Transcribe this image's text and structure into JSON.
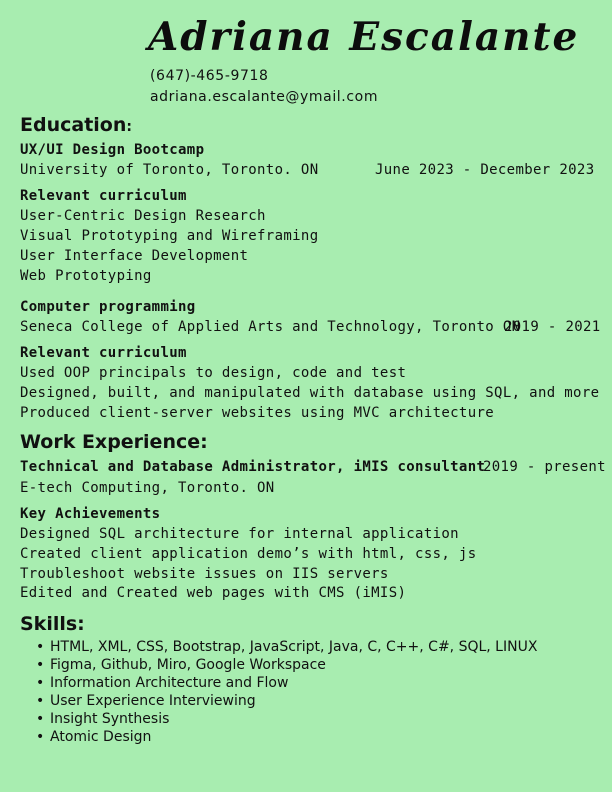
{
  "header": {
    "name": "Adriana Escalante",
    "phone": "(647)-465-9718",
    "email": "adriana.escalante@ymail.com"
  },
  "education": {
    "title": "Education",
    "colon": ":",
    "programs": [
      {
        "name": "UX/UI Design Bootcamp",
        "school": "University of Toronto, Toronto. ON",
        "dates": "June 2023 - December 2023",
        "curriculum_label": "Relevant curriculum",
        "curriculum": [
          "User-Centric Design Research",
          "Visual Prototyping and Wireframing",
          "User Interface Development",
          "Web Prototyping"
        ]
      },
      {
        "name": "Computer programming",
        "school": "Seneca College of Applied Arts and Technology, Toronto ON",
        "dates": "2019 - 2021",
        "curriculum_label": "Relevant curriculum",
        "curriculum": [
          "Used OOP principals to design, code and test",
          "Designed, built, and manipulated with database using SQL, and more",
          "Produced client-server websites using MVC architecture"
        ]
      }
    ]
  },
  "work": {
    "title": "Work Experience:",
    "role": "Technical and Database Administrator, iMIS consultant",
    "dates": "2019 - present",
    "company": "E-tech Computing, Toronto. ON",
    "achievements_label": "Key Achievements",
    "achievements": [
      "Designed SQL architecture for internal application",
      "Created client application demo’s with html, css, js",
      "Troubleshoot website issues on IIS servers",
      "Edited and Created web pages with CMS (iMIS)"
    ]
  },
  "skills": {
    "title": "Skills:",
    "bullet": "•",
    "items": [
      "HTML, XML, CSS, Bootstrap, JavaScript, Java, C, C++, C#, SQL, LINUX",
      "Figma, Github, Miro, Google Workspace",
      "Information Architecture and Flow",
      "User Experience Interviewing",
      "Insight Synthesis",
      "Atomic Design"
    ]
  }
}
